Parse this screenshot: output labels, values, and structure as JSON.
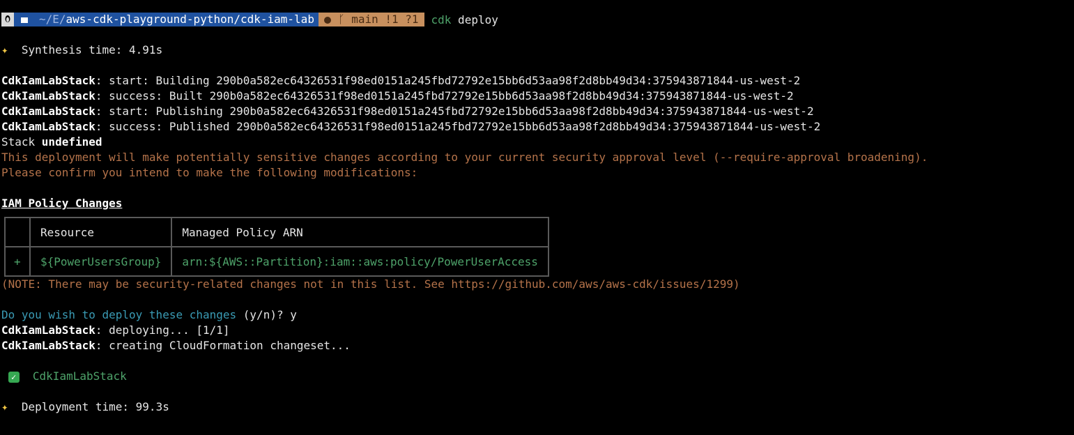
{
  "prompt": {
    "os_icon": "linux-icon",
    "folder_icon": "folder-icon",
    "path_prefix": "~/E/",
    "path_rest": "aws-cdk-playground-python/cdk-iam-lab",
    "git_icon": "github-icon",
    "branch_icon": "branch-icon",
    "git_status": "main !1 ?1",
    "command_name": "cdk",
    "command_args": " deploy"
  },
  "synthesis": {
    "icon": "sparkles-icon",
    "text": "  Synthesis time: 4.91s"
  },
  "asset_lines": [
    {
      "stack": "CdkIamLabStack",
      "text": ": start: Building 290b0a582ec64326531f98ed0151a245fbd72792e15bb6d53aa98f2d8bb49d34:375943871844-us-west-2"
    },
    {
      "stack": "CdkIamLabStack",
      "text": ": success: Built 290b0a582ec64326531f98ed0151a245fbd72792e15bb6d53aa98f2d8bb49d34:375943871844-us-west-2"
    },
    {
      "stack": "CdkIamLabStack",
      "text": ": start: Publishing 290b0a582ec64326531f98ed0151a245fbd72792e15bb6d53aa98f2d8bb49d34:375943871844-us-west-2"
    },
    {
      "stack": "CdkIamLabStack",
      "text": ": success: Published 290b0a582ec64326531f98ed0151a245fbd72792e15bb6d53aa98f2d8bb49d34:375943871844-us-west-2"
    }
  ],
  "stack_line": {
    "prefix": "Stack ",
    "value": "undefined"
  },
  "warning_lines": [
    "This deployment will make potentially sensitive changes according to your current security approval level (--require-approval broadening).",
    "Please confirm you intend to make the following modifications:"
  ],
  "iam_section_title": "IAM Policy Changes",
  "iam_table": {
    "headers": [
      "",
      "Resource",
      "Managed Policy ARN"
    ],
    "row": {
      "sign": "+",
      "resource": "${PowerUsersGroup}",
      "arn": "arn:${AWS::Partition}:iam::aws:policy/PowerUserAccess"
    }
  },
  "note_line": "(NOTE: There may be security-related changes not in this list. See https://github.com/aws/aws-cdk/issues/1299)",
  "confirm": {
    "question": "Do you wish to deploy these changes",
    "choices": " (y/n)? ",
    "answer": "y"
  },
  "deploy_lines": [
    {
      "stack": "CdkIamLabStack",
      "text": ": deploying... [1/1]"
    },
    {
      "stack": "CdkIamLabStack",
      "text": ": creating CloudFormation changeset..."
    }
  ],
  "result": {
    "icon": "check-mark-icon",
    "stack": "CdkIamLabStack"
  },
  "deployment": {
    "icon": "sparkles-icon",
    "text": "  Deployment time: 99.3s"
  },
  "colors": {
    "background": "#000000",
    "warning": "#b5734a",
    "prompt_question": "#3a9bb5",
    "success": "#4ea36a",
    "path_segment": "#1f52a0",
    "git_segment": "#c8905e"
  }
}
